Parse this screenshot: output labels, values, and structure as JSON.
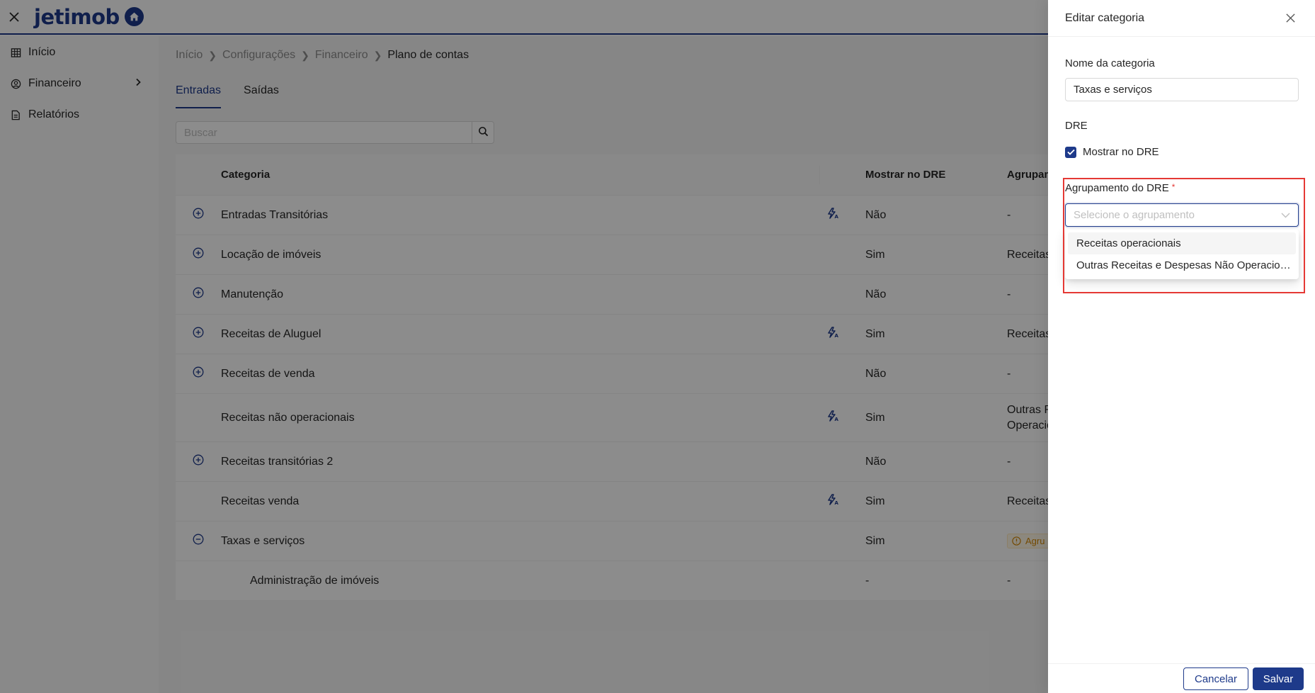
{
  "logo": {
    "text": "jetimob"
  },
  "sidebar": {
    "items": [
      {
        "label": "Início",
        "icon": "table-icon"
      },
      {
        "label": "Financeiro",
        "icon": "finance-icon"
      },
      {
        "label": "Relatórios",
        "icon": "report-icon"
      }
    ]
  },
  "breadcrumb": [
    "Início",
    "Configurações",
    "Financeiro",
    "Plano de contas"
  ],
  "tabs": [
    "Entradas",
    "Saídas"
  ],
  "search": {
    "placeholder": "Buscar"
  },
  "table": {
    "headers": {
      "category": "Categoria",
      "show_dre": "Mostrar no DRE",
      "grouping": "Agrupam"
    },
    "rows": [
      {
        "category": "Entradas Transitórias",
        "show_dre": "Não",
        "grouping": "-"
      },
      {
        "category": "Locação de imóveis",
        "show_dre": "Sim",
        "grouping": "Receitas o"
      },
      {
        "category": "Manutenção",
        "show_dre": "Não",
        "grouping": "-"
      },
      {
        "category": "Receitas de Aluguel",
        "show_dre": "Sim",
        "grouping": "Receitas o"
      },
      {
        "category": "Receitas de venda",
        "show_dre": "Não",
        "grouping": "-"
      },
      {
        "category": "Receitas não operacionais",
        "show_dre": "Sim",
        "grouping": "Outras Re",
        "grouping2": "Operacio"
      },
      {
        "category": "Receitas transitórias 2",
        "show_dre": "Não",
        "grouping": "-"
      },
      {
        "category": "Receitas venda",
        "show_dre": "Sim",
        "grouping": "Receitas o"
      },
      {
        "category": "Taxas e serviços",
        "show_dre": "Sim",
        "grouping": "Agru"
      },
      {
        "category": "Administração de imóveis",
        "show_dre": "-",
        "grouping": "-"
      }
    ]
  },
  "drawer": {
    "title": "Editar categoria",
    "name_label": "Nome da categoria",
    "name_value": "Taxas e serviços",
    "dre_section": "DRE",
    "show_dre_label": "Mostrar no DRE",
    "grouping_label": "Agrupamento do DRE",
    "required_mark": "*",
    "grouping_placeholder": "Selecione o agrupamento",
    "options": [
      "Receitas operacionais",
      "Outras Receitas e Despesas Não Operacio…"
    ],
    "cancel": "Cancelar",
    "save": "Salvar"
  },
  "colors": {
    "brand": "#1e3a8a",
    "highlight": "#e53935",
    "warning": "#d48806"
  }
}
